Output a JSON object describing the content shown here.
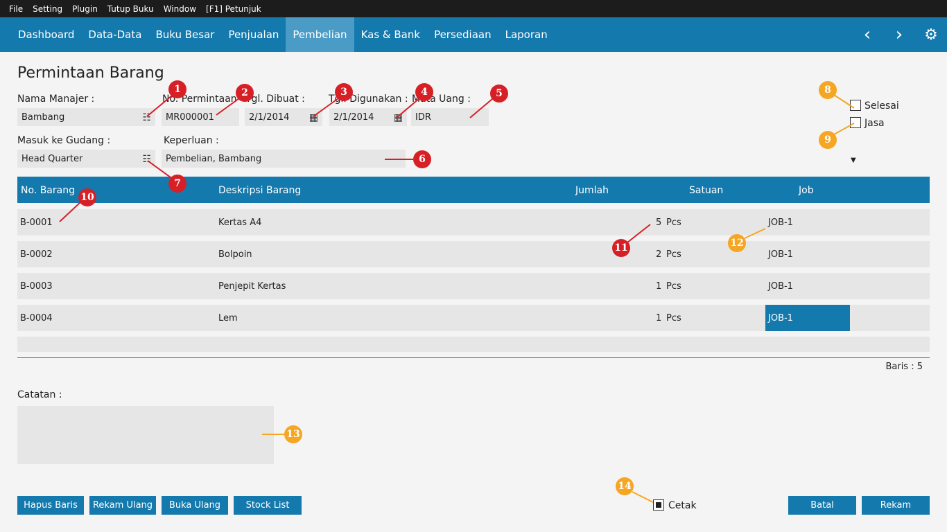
{
  "menubar": {
    "items": [
      "File",
      "Setting",
      "Plugin",
      "Tutup Buku",
      "Window",
      "[F1] Petunjuk"
    ]
  },
  "navbar": {
    "tabs": [
      "Dashboard",
      "Data-Data",
      "Buku Besar",
      "Penjualan",
      "Pembelian",
      "Kas & Bank",
      "Persediaan",
      "Laporan"
    ],
    "active": "Pembelian"
  },
  "page": {
    "title": "Permintaan Barang"
  },
  "form": {
    "manager_label": "Nama Manajer  :",
    "manager_value": "Bambang",
    "request_no_label": "No. Permintaan",
    "request_no_value": "MR000001",
    "created_label": "Tgl. Dibuat :",
    "created_value": "2/1/2014",
    "used_label": "Tgl. Digunakan :",
    "used_value": "2/1/2014",
    "currency_label": "Mata Uang :",
    "currency_value": "IDR",
    "warehouse_label": "Masuk ke Gudang :",
    "warehouse_value": "Head Quarter",
    "purpose_label": "Keperluan :",
    "purpose_value": "Pembelian, Bambang",
    "selesai_label": "Selesai",
    "jasa_label": "Jasa"
  },
  "table": {
    "headers": [
      "No. Barang",
      "Deskripsi Barang",
      "Jumlah",
      "Satuan",
      "Job"
    ],
    "rows": [
      {
        "no": "B-0001",
        "desc": "Kertas A4",
        "qty": "5",
        "unit": "Pcs",
        "job": "JOB-1"
      },
      {
        "no": "B-0002",
        "desc": "Bolpoin",
        "qty": "2",
        "unit": "Pcs",
        "job": "JOB-1"
      },
      {
        "no": "B-0003",
        "desc": "Penjepit Kertas",
        "qty": "1",
        "unit": "Pcs",
        "job": "JOB-1"
      },
      {
        "no": "B-0004",
        "desc": "Lem",
        "qty": "1",
        "unit": "Pcs",
        "job": "JOB-1"
      }
    ],
    "row_count": "Baris : 5"
  },
  "notes": {
    "label": "Catatan :"
  },
  "buttons": {
    "hapus": "Hapus Baris",
    "rekam_ulang": "Rekam Ulang",
    "buka_ulang": "Buka Ulang",
    "stock_list": "Stock List",
    "cetak": "Cetak",
    "batal": "Batal",
    "rekam": "Rekam"
  },
  "badges": [
    "1",
    "2",
    "3",
    "4",
    "5",
    "6",
    "7",
    "8",
    "9",
    "10",
    "11",
    "12",
    "13",
    "14"
  ],
  "colors": {
    "accent": "#1479ad",
    "badge_red": "#d71f26",
    "badge_orange": "#f5a623"
  }
}
